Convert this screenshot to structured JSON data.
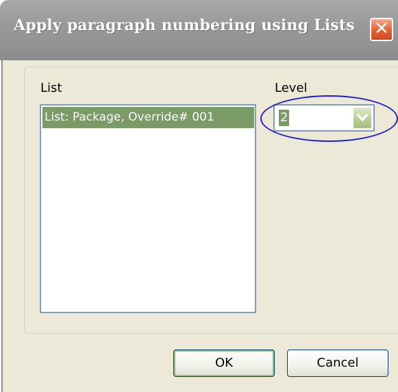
{
  "window": {
    "title": "Apply paragraph numbering using Lists",
    "close_icon": "close-icon",
    "close_glyph": "✕"
  },
  "list": {
    "label": "List",
    "items": [
      {
        "label": "List: Package, Override# 001",
        "selected": true
      }
    ]
  },
  "level": {
    "label": "Level",
    "value": "2",
    "dropdown_icon": "chevron-down-icon"
  },
  "buttons": {
    "ok_label": "OK",
    "cancel_label": "Cancel"
  },
  "colors": {
    "selection": "#7a9a66",
    "annotation_ellipse": "#1e1ecf",
    "close_button": "#e2673a"
  }
}
